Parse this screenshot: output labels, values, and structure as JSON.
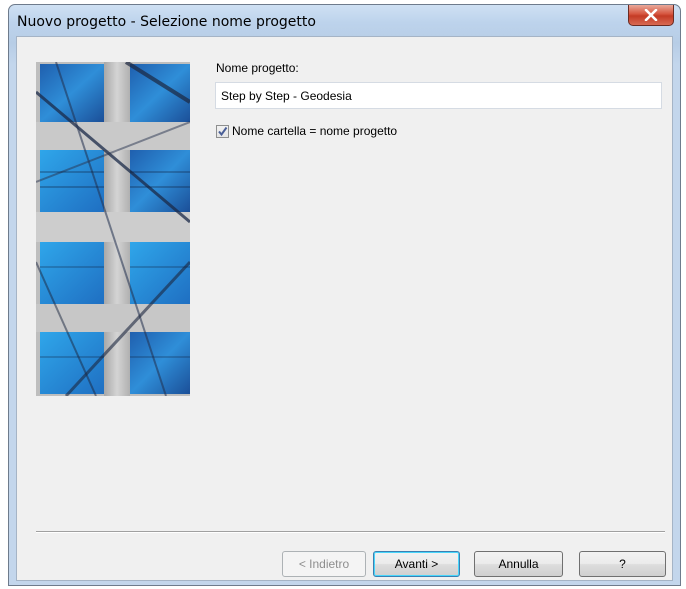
{
  "window": {
    "title": "Nuovo progetto - Selezione nome progetto"
  },
  "form": {
    "name_label": "Nome progetto:",
    "name_value": "Step by Step - Geodesia",
    "checkbox_label": "Nome cartella = nome progetto",
    "checkbox_checked": true
  },
  "buttons": {
    "back": "< Indietro",
    "next": "Avanti >",
    "cancel": "Annulla",
    "help": "?"
  },
  "icons": {
    "close": "close-icon",
    "check": "checkmark-icon",
    "banner": "building-facade-image"
  }
}
